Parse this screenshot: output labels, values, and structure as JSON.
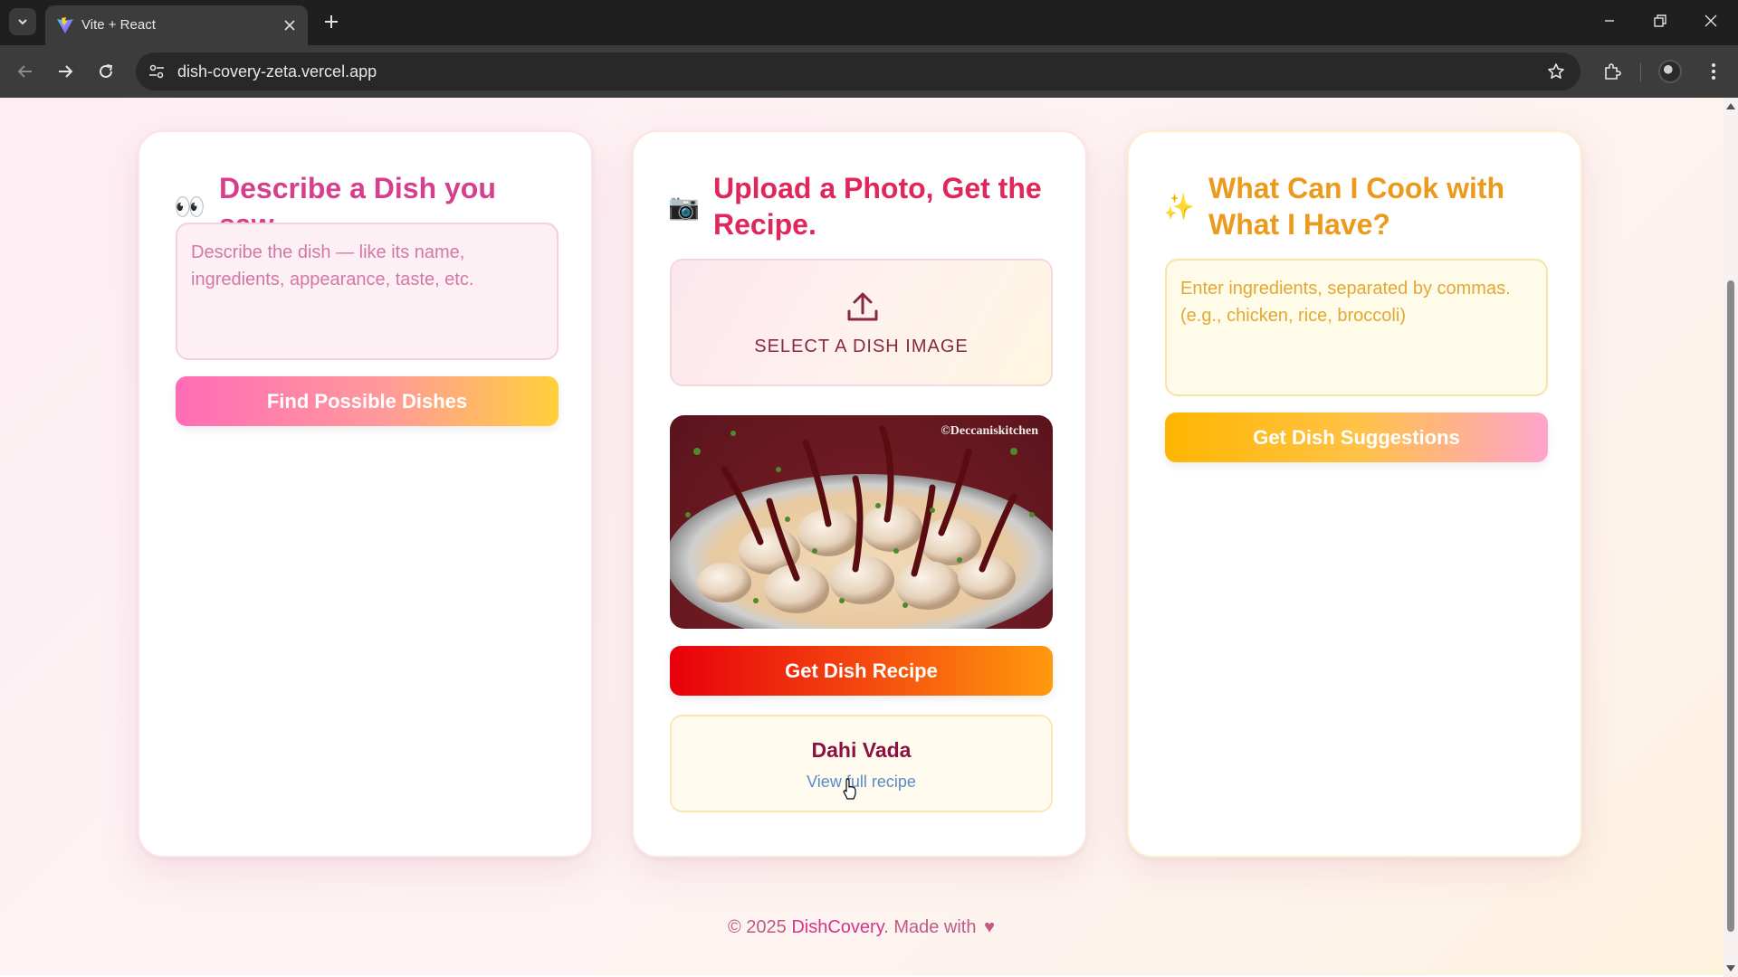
{
  "browser": {
    "tab_title": "Vite + React",
    "url": "dish-covery-zeta.vercel.app"
  },
  "cards": {
    "describe": {
      "emoji": "👀",
      "title": "Describe a Dish you saw.",
      "placeholder": "Describe the dish — like its name, ingredients, appearance, taste, etc.",
      "button": "Find Possible Dishes"
    },
    "upload": {
      "emoji": "📷",
      "title": "Upload a Photo, Get the Recipe.",
      "select_label": "SELECT A DISH IMAGE",
      "photo_watermark": "©Deccaniskitchen",
      "button": "Get Dish Recipe",
      "result": {
        "dish_name": "Dahi Vada",
        "link_text": "View full recipe"
      }
    },
    "pantry": {
      "emoji": "✨",
      "title": "What Can I Cook with What I Have?",
      "placeholder": "Enter ingredients, separated by commas. (e.g., chicken, rice, broccoli)",
      "button": "Get Dish Suggestions"
    }
  },
  "footer": {
    "copyright": "© 2025",
    "brand": "DishCovery",
    "made_with": ". Made with",
    "heart": "♥"
  },
  "colors": {
    "describe_title": "#d63f8c",
    "upload_title": "#e0265a",
    "pantry_title": "#ec9a1b",
    "brand": "#d8338b"
  },
  "icons": [
    "tab-search-icon",
    "vite-favicon-icon",
    "close-icon",
    "plus-icon",
    "minimize-icon",
    "restore-icon",
    "back-icon",
    "forward-icon",
    "reload-icon",
    "site-info-icon",
    "bookmark-star-icon",
    "extensions-icon",
    "menu-icon",
    "upload-icon",
    "cursor-icon"
  ]
}
